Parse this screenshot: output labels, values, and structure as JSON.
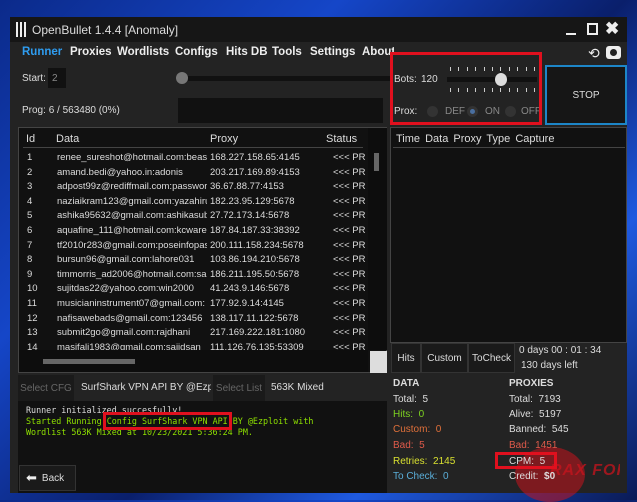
{
  "window": {
    "title": "OpenBullet 1.4.4 [Anomaly]"
  },
  "menu": [
    "Runner",
    "Proxies",
    "Wordlists",
    "Configs",
    "Hits DB",
    "Tools",
    "Settings",
    "About"
  ],
  "runner": {
    "start_label": "Start:",
    "start_value": "2",
    "prog_label": "Prog:",
    "prog_value": "6 / 563480 (0%)",
    "bots_label": "Bots:",
    "bots_value": "120",
    "bots_slider_fraction": 0.6,
    "prox_label": "Prox:",
    "prox_options": [
      "DEF",
      "ON",
      "OFF"
    ],
    "prox_selected": "ON",
    "stop_label": "STOP"
  },
  "table": {
    "headers": [
      "Id",
      "Data",
      "Proxy",
      "Status"
    ],
    "rows": [
      [
        "1",
        "renee_sureshot@hotmail.com:beast",
        "168.227.158.65:4145",
        "<<< PR"
      ],
      [
        "2",
        "amand.bedi@yahoo.in:adonis",
        "203.217.169.89:4153",
        "<<< PR"
      ],
      [
        "3",
        "adpost99z@rediffmail.com:passwor",
        "36.67.88.77:4153",
        "<<< PR"
      ],
      [
        "4",
        "naziaikram123@gmail.com:yazahiru",
        "182.23.95.129:5678",
        "<<< PR"
      ],
      [
        "5",
        "ashika95632@gmail.com:ashikasubl",
        "27.72.173.14:5678",
        "<<< PR"
      ],
      [
        "6",
        "aquafine_111@hotmail.com:kcwarel",
        "187.84.187.33:38392",
        "<<< PR"
      ],
      [
        "7",
        "tf2010r283@gmail.com:poseinfopas",
        "200.111.158.234:5678",
        "<<< PR"
      ],
      [
        "8",
        "bursun96@gmail.com:lahore031",
        "103.86.194.210:5678",
        "<<< PR"
      ],
      [
        "9",
        "timmorris_ad2006@hotmail.com:sa",
        "186.211.195.50:5678",
        "<<< PR"
      ],
      [
        "10",
        "sujitdas22@yahoo.com:win2000",
        "41.243.9.146:5678",
        "<<< PR"
      ],
      [
        "11",
        "musicianinstrument07@gmail.com:",
        "177.92.9.14:4145",
        "<<< PR"
      ],
      [
        "12",
        "nafisawebads@gmail.com:123456",
        "138.117.11.122:5678",
        "<<< PR"
      ],
      [
        "13",
        "submit2go@gmail.com:rajdhani",
        "217.169.222.181:1080",
        "<<< PR"
      ],
      [
        "14",
        "masifali1983@gmail.com:sajidsan",
        "111.126.76.135:53309",
        "<<< PR"
      ]
    ]
  },
  "capture": {
    "headers": [
      "Time",
      "Data",
      "Proxy",
      "Type",
      "Capture"
    ]
  },
  "filters": [
    "Hits",
    "Custom",
    "ToCheck"
  ],
  "timer": {
    "elapsed": "0 days 00 : 01 : 34",
    "left": "130 days left"
  },
  "selectors": {
    "cfg_button": "Select CFG",
    "cfg_value": "SurfShark VPN API BY @Ezploit",
    "list_button": "Select List",
    "list_value": "563K Mixed"
  },
  "log": {
    "line1": "Runner initialized succesfully!",
    "line2a": "Started Running ",
    "line2b": "Config SurfShark VPN API",
    "line2c": " BY @Ezploit with",
    "line3": "Wordlist 563K Mixed at 10/23/2021 5:36:24 PM."
  },
  "back_label": "Back",
  "data_stats": {
    "title": "DATA",
    "total_label": "Total:",
    "total": "5",
    "hits_label": "Hits:",
    "hits": "0",
    "custom_label": "Custom:",
    "custom": "0",
    "bad_label": "Bad:",
    "bad": "5",
    "retries_label": "Retries:",
    "retries": "2145",
    "tocheck_label": "To Check:",
    "tocheck": "0"
  },
  "proxy_stats": {
    "title": "PROXIES",
    "total_label": "Total:",
    "total": "7193",
    "alive_label": "Alive:",
    "alive": "5197",
    "banned_label": "Banned:",
    "banned": "545",
    "bad_label": "Bad:",
    "bad": "1451",
    "cpm_label": "CPM:",
    "cpm": "5",
    "credit_label": "Credit:",
    "credit": "$0"
  },
  "watermark": "RAX FORUM",
  "colors": {
    "accent": "#2e9cf0",
    "highlight": "#e0101e",
    "hits": "#7ed321",
    "custom": "#e0703a",
    "bad": "#e05a4a",
    "retries": "#d8e030",
    "tocheck": "#5aaed8",
    "log_green": "#8ee000"
  }
}
